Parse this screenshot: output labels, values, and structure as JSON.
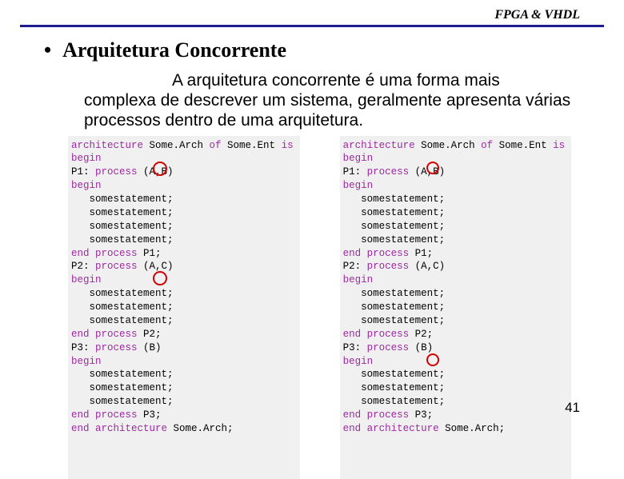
{
  "header": "FPGA & VHDL",
  "title": "Arquitetura Concorrente",
  "body": "A arquitetura concorrente é uma forma mais complexa de descrever um sistema, geralmente apresenta várias processos dentro de uma arquitetura.",
  "code_left": {
    "l1a": "architecture",
    "l1b": " Some.Arch ",
    "l1c": "of",
    "l1d": " Some.Ent ",
    "l1e": "is",
    "l2": "begin",
    "l3a": "P1: ",
    "l3b": "process",
    "l3c": " (A,B)",
    "l4": "begin",
    "l5": "   somestatement;",
    "l6": "   somestatement;",
    "l7": "   somestatement;",
    "l8": "   somestatement;",
    "l9a": "end process",
    "l9b": " P1;",
    "l10a": "P2: ",
    "l10b": "process",
    "l10c": " (A,C)",
    "l11": "begin",
    "l12": "   somestatement;",
    "l13": "   somestatement;",
    "l14": "   somestatement;",
    "l15a": "end process",
    "l15b": " P2;",
    "l16a": "P3: ",
    "l16b": "process",
    "l16c": " (B)",
    "l17": "begin",
    "l18": "   somestatement;",
    "l19": "   somestatement;",
    "l20": "   somestatement;",
    "l21a": "end process",
    "l21b": " P3;",
    "l22a": "end architecture",
    "l22b": " Some.Arch;"
  },
  "code_right": {
    "l1a": "architecture",
    "l1b": " Some.Arch ",
    "l1c": "of",
    "l1d": " Some.Ent ",
    "l1e": "is",
    "l2": "begin",
    "l3a": "P1: ",
    "l3b": "process",
    "l3c": " (A,B)",
    "l4": "begin",
    "l5": "   somestatement;",
    "l6": "   somestatement;",
    "l7": "   somestatement;",
    "l8": "   somestatement;",
    "l9a": "end process",
    "l9b": " P1;",
    "l10a": "P2: ",
    "l10b": "process",
    "l10c": " (A,C)",
    "l11": "begin",
    "l12": "   somestatement;",
    "l13": "   somestatement;",
    "l14": "   somestatement;",
    "l15a": "end process",
    "l15b": " P2;",
    "l16a": "P3: ",
    "l16b": "process",
    "l16c": " (B)",
    "l17": "begin",
    "l18": "   somestatement;",
    "l19": "   somestatement;",
    "l20": "   somestatement;",
    "l21a": "end process",
    "l21b": " P3;",
    "l22a": "end architecture",
    "l22b": " Some.Arch;"
  },
  "page_number": "41"
}
